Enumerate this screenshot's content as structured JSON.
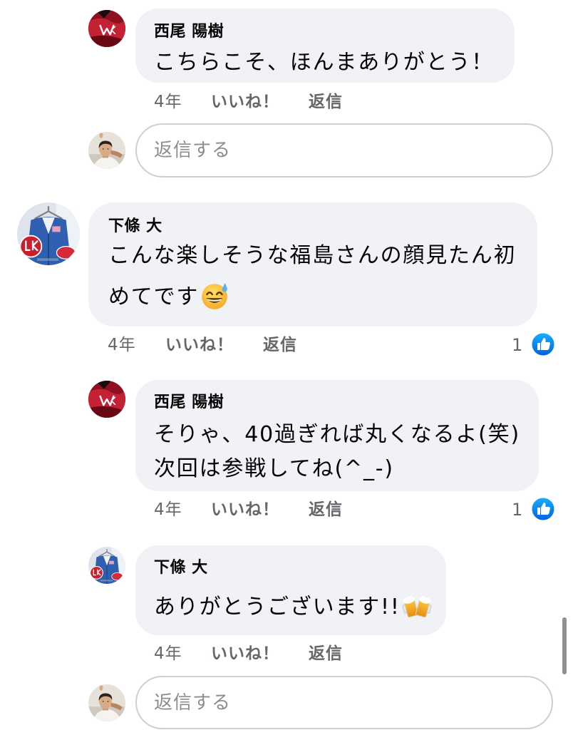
{
  "colors": {
    "bubble": "#f0f2f5",
    "text": "#050505",
    "meta": "#65676b",
    "like_blue": "#1877f2",
    "input_border": "#ccd0d5"
  },
  "thread": {
    "reply_1": {
      "author": "西尾 陽樹",
      "text": "こちらこそ、ほんまありがとう！",
      "time": "4年",
      "like_label": "いいね！",
      "reply_label": "返信"
    },
    "reply_box_1": {
      "placeholder": "返信する"
    },
    "comment": {
      "author": "下條 大",
      "lines": [
        "こんな楽しそうな福島さんの顔見たん初",
        "めてです"
      ],
      "emoji": "sweat-smile-emoji-icon",
      "time": "4年",
      "like_label": "いいね！",
      "reply_label": "返信",
      "reaction_count": "1",
      "reaction_icon": "like-icon"
    },
    "reply_2": {
      "author": "西尾 陽樹",
      "lines": [
        "そりゃ、40過ぎれば丸くなるよ(笑)",
        "次回は参戦してね(^_-)"
      ],
      "time": "4年",
      "like_label": "いいね！",
      "reply_label": "返信",
      "reaction_count": "1",
      "reaction_icon": "like-icon"
    },
    "reply_3": {
      "author": "下條 大",
      "text": "ありがとうございます!!",
      "emoji": "beer-mugs-emoji-icon",
      "time": "4年",
      "like_label": "いいね！",
      "reply_label": "返信"
    },
    "reply_box_2": {
      "placeholder": "返信する"
    }
  }
}
